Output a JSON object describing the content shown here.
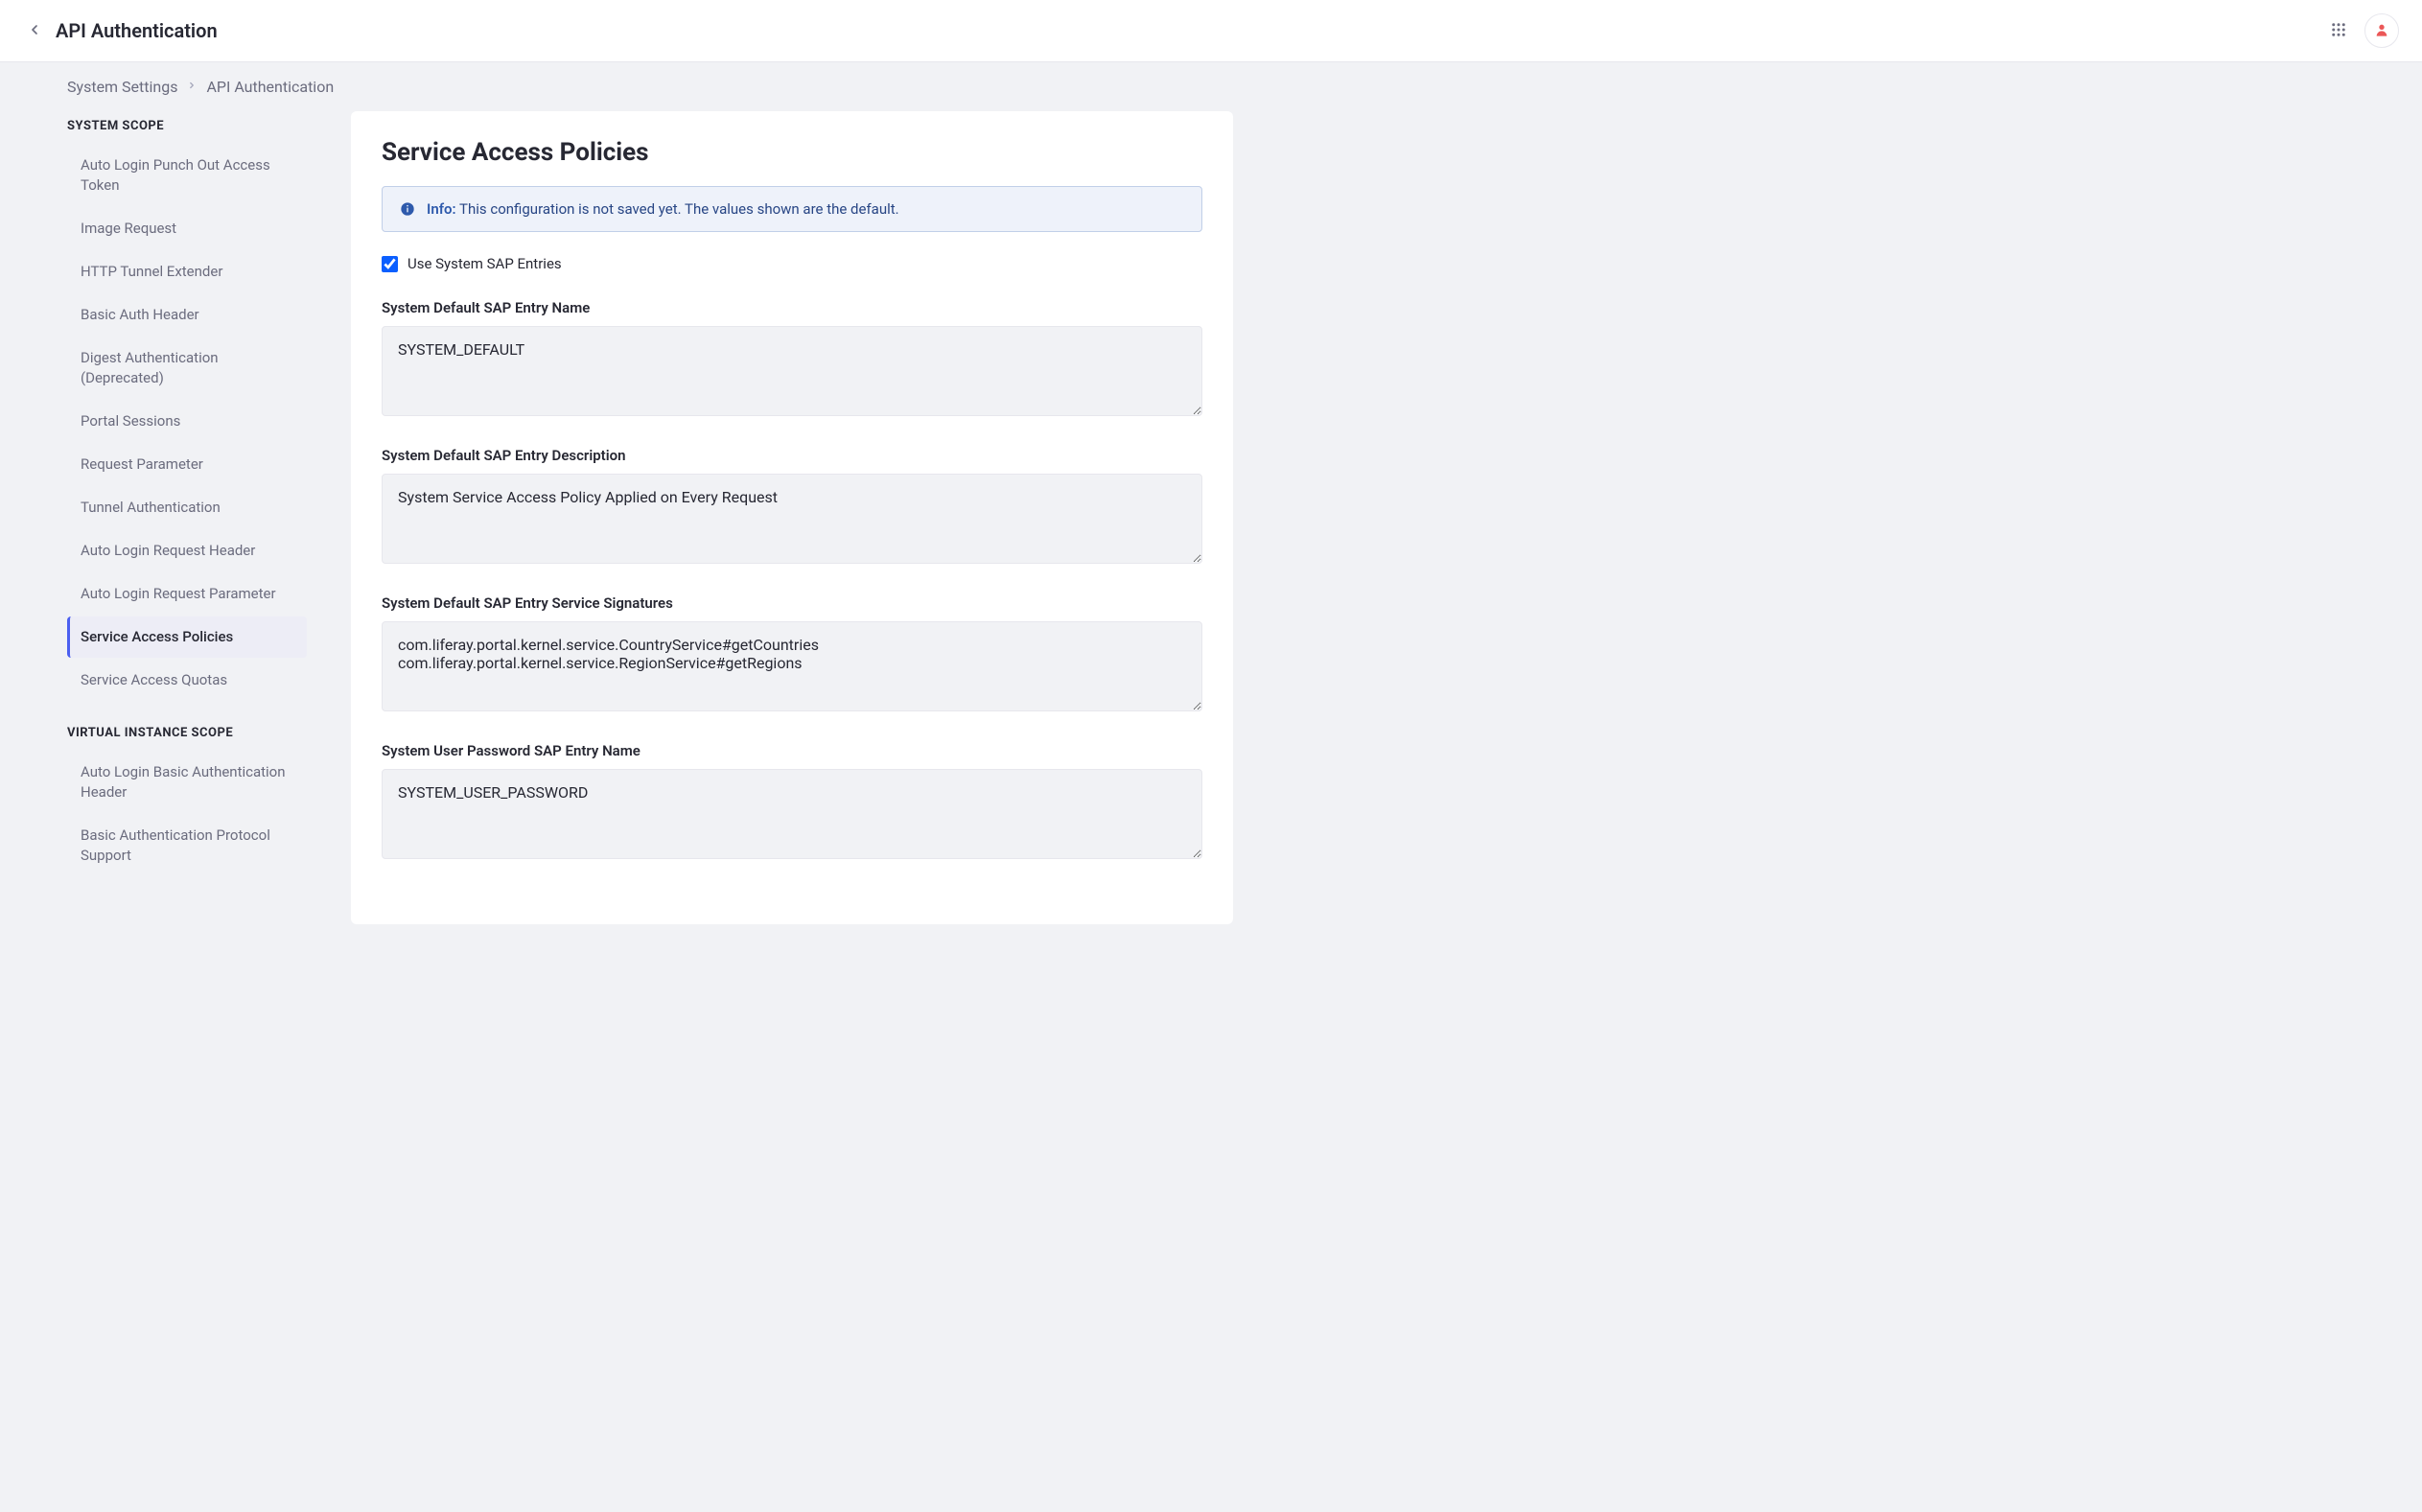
{
  "header": {
    "title": "API Authentication"
  },
  "breadcrumb": {
    "item0": "System Settings",
    "item1": "API Authentication"
  },
  "sidebar": {
    "systemScopeHeader": "SYSTEM SCOPE",
    "virtualScopeHeader": "VIRTUAL INSTANCE SCOPE",
    "systemItems": [
      {
        "label": "Auto Login Punch Out Access Token"
      },
      {
        "label": "Image Request"
      },
      {
        "label": "HTTP Tunnel Extender"
      },
      {
        "label": "Basic Auth Header"
      },
      {
        "label": "Digest Authentication (Deprecated)"
      },
      {
        "label": "Portal Sessions"
      },
      {
        "label": "Request Parameter"
      },
      {
        "label": "Tunnel Authentication"
      },
      {
        "label": "Auto Login Request Header"
      },
      {
        "label": "Auto Login Request Parameter"
      },
      {
        "label": "Service Access Policies"
      },
      {
        "label": "Service Access Quotas"
      }
    ],
    "virtualItems": [
      {
        "label": "Auto Login Basic Authentication Header"
      },
      {
        "label": "Basic Authentication Protocol Support"
      }
    ]
  },
  "panel": {
    "title": "Service Access Policies",
    "infoLabel": "Info:",
    "infoText": "This configuration is not saved yet. The values shown are the default.",
    "useSystemSAPLabel": "Use System SAP Entries",
    "useSystemSAPChecked": true,
    "fields": {
      "defaultName": {
        "label": "System Default SAP Entry Name",
        "value": "SYSTEM_DEFAULT"
      },
      "defaultDescription": {
        "label": "System Default SAP Entry Description",
        "value": "System Service Access Policy Applied on Every Request"
      },
      "signatures": {
        "label": "System Default SAP Entry Service Signatures",
        "value": "com.liferay.portal.kernel.service.CountryService#getCountries\ncom.liferay.portal.kernel.service.RegionService#getRegions"
      },
      "userPasswordName": {
        "label": "System User Password SAP Entry Name",
        "value": "SYSTEM_USER_PASSWORD"
      }
    }
  }
}
